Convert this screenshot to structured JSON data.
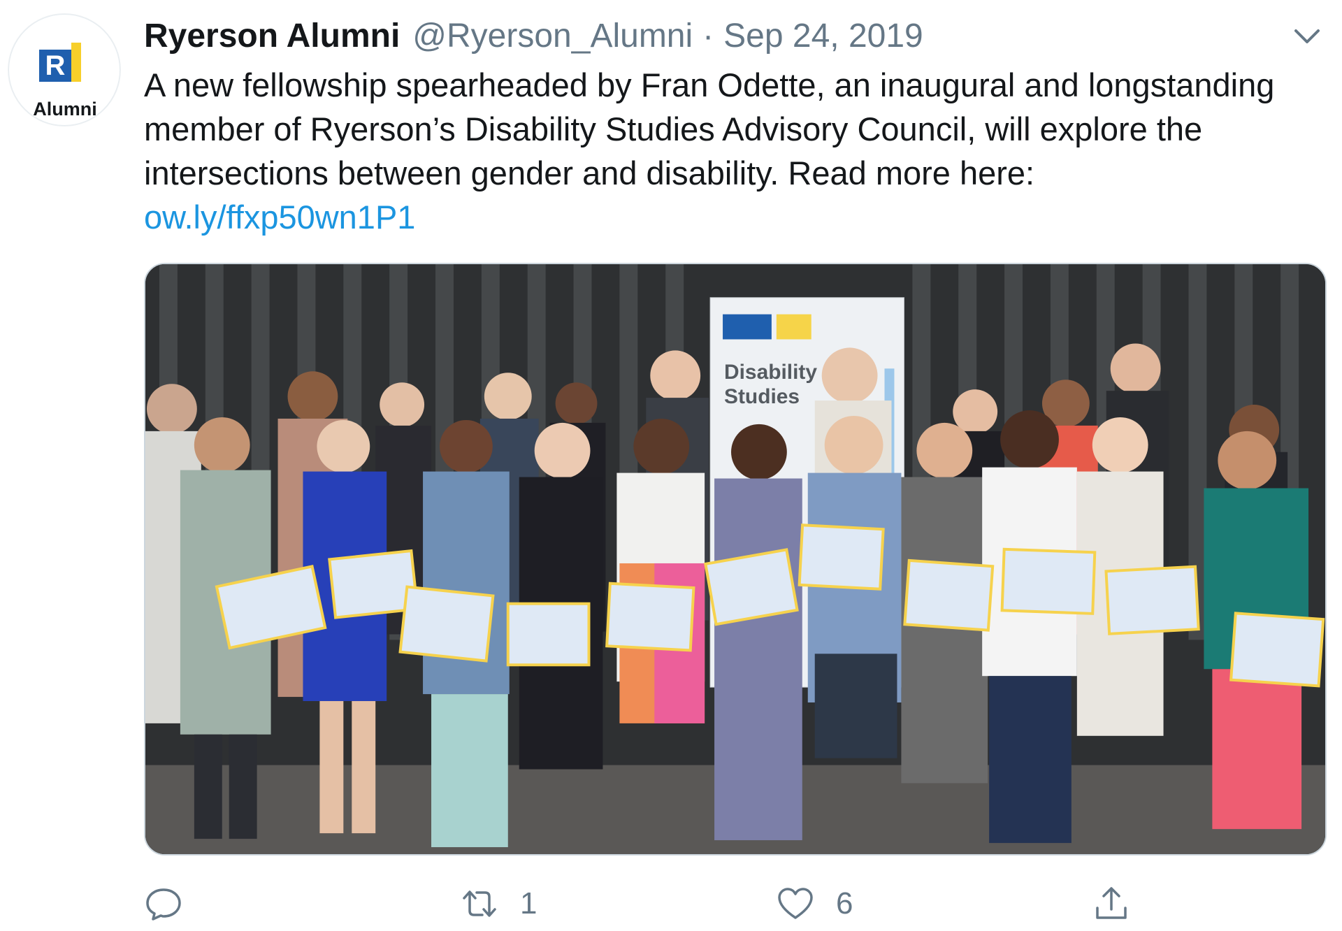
{
  "author": {
    "display_name": "Ryerson Alumni",
    "handle": "@Ryerson_Alumni",
    "separator": "·",
    "date": "Sep 24, 2019",
    "avatar": {
      "logo_letter": "R",
      "label": "Alumni",
      "brand_blue": "#1f5fae",
      "brand_yellow": "#f7cf2a"
    }
  },
  "tweet": {
    "text": "A new fellowship spearheaded by Fran Odette, an inaugural and longstanding member of Ryerson’s Disability Studies Advisory Council, will explore the intersections between gender and disability. Read more here:",
    "link": "ow.ly/ffxp50wn1P1",
    "link_color": "#1b95e0"
  },
  "photo": {
    "banner_lines": [
      "Disability",
      "Studies"
    ]
  },
  "actions": {
    "reply": {
      "icon": "reply-icon",
      "count": ""
    },
    "retweet": {
      "icon": "retweet-icon",
      "count": "1"
    },
    "like": {
      "icon": "heart-icon",
      "count": "6"
    },
    "share": {
      "icon": "share-icon",
      "count": ""
    }
  },
  "menu": {
    "icon": "chevron-down-icon"
  }
}
